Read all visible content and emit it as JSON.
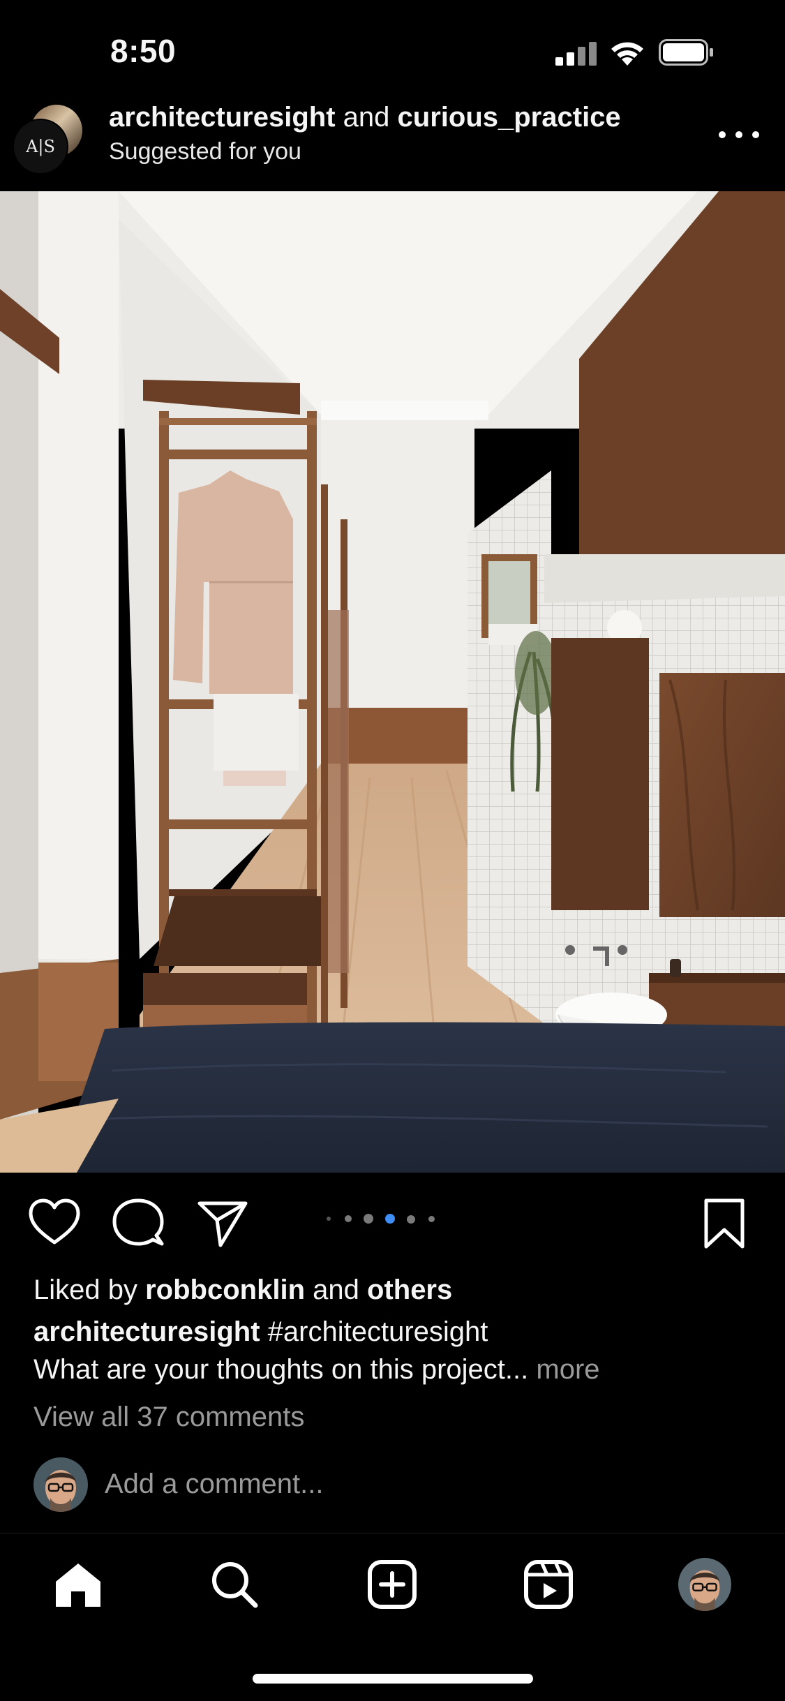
{
  "status_bar": {
    "time": "8:50",
    "icons": [
      "cellular-signal-icon",
      "wifi-icon",
      "battery-icon"
    ]
  },
  "post_header": {
    "account_primary": "architecturesight",
    "joiner": "and",
    "account_secondary": "curious_practice",
    "subtitle": "Suggested for you",
    "avatar_monogram": "A|S"
  },
  "carousel": {
    "total_dots": 5,
    "active_index": 2
  },
  "actions": {
    "icons": [
      "heart-icon",
      "comment-icon",
      "share-icon",
      "bookmark-icon"
    ]
  },
  "likes": {
    "prefix": "Liked by",
    "user": "robbconklin",
    "joiner": "and",
    "others": "others"
  },
  "caption": {
    "username": "architecturesight",
    "hashtag": "#architecturesight",
    "text": "What are your thoughts on this project...",
    "more_label": "more"
  },
  "comments": {
    "view_all_label": "View all 37 comments",
    "add_placeholder": "Add a comment..."
  },
  "tab_bar": {
    "tabs": [
      "home-icon",
      "search-icon",
      "create-icon",
      "reels-icon",
      "profile-icon"
    ]
  },
  "colors": {
    "background": "#000000",
    "text": "#f5f5f5",
    "muted_text": "#9a9a9a",
    "active_dot": "#3f8ef5"
  }
}
